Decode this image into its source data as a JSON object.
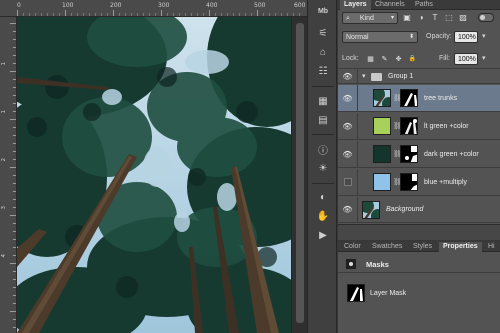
{
  "ruler_top": {
    "labels": [
      "0",
      "100",
      "200",
      "300",
      "400",
      "500",
      "600"
    ]
  },
  "ruler_left": {
    "labels": [
      "1",
      "1",
      "2",
      "3",
      "4"
    ]
  },
  "tools": [
    "mini-bridge-icon",
    "adjustments-icon",
    "paths-icon",
    "character-icon",
    "brushes-icon",
    "history-icon",
    "info-icon",
    "color-icon",
    "navigator-icon",
    "actions-icon",
    "play-icon"
  ],
  "tool_glyphs": [
    "Mb",
    "⚟",
    "⌂",
    "☷",
    "▦",
    "▤",
    "ⓘ",
    "☀",
    "◐",
    "✋",
    "▶"
  ],
  "layers_panel": {
    "tabs": [
      "Layers",
      "Channels",
      "Paths"
    ],
    "filter": {
      "kind_label": "Kind",
      "icons": [
        "image-filter-icon",
        "adjustment-filter-icon",
        "type-filter-icon",
        "shape-filter-icon",
        "smart-object-filter-icon"
      ],
      "glyphs": [
        "▣",
        "◑",
        "T",
        "⬚",
        "▨"
      ]
    },
    "blend_mode": "Normal",
    "opacity_label": "Opacity:",
    "opacity_value": "100%",
    "lock_label": "Lock:",
    "lock_icons": [
      "lock-transparent-icon",
      "lock-image-icon",
      "lock-position-icon",
      "lock-all-icon"
    ],
    "lock_glyphs": [
      "▦",
      "✎",
      "✥",
      "🔒"
    ],
    "fill_label": "Fill:",
    "fill_value": "100%",
    "group": {
      "name": "Group 1",
      "expanded": true
    },
    "layers": [
      {
        "name": "tree trunks",
        "visible": true,
        "selected": true,
        "thumb_color": "#3a5a6a",
        "has_mask": true,
        "in_group": true
      },
      {
        "name": "lt green +color",
        "visible": true,
        "selected": false,
        "thumb_color": "#a8d05a",
        "has_mask": true,
        "in_group": true
      },
      {
        "name": "dark green +color",
        "visible": true,
        "selected": false,
        "thumb_color": "#13352c",
        "has_mask": true,
        "in_group": true
      },
      {
        "name": "blue +multiply",
        "visible": false,
        "selected": false,
        "thumb_color": "#8fc3ea",
        "has_mask": true,
        "in_group": true
      },
      {
        "name": "Background",
        "visible": true,
        "selected": false,
        "thumb_color": "#3a5a6a",
        "has_mask": false,
        "in_group": false,
        "italic": true
      }
    ]
  },
  "properties_panel": {
    "tabs": [
      "Color",
      "Swatches",
      "Styles",
      "Properties",
      "Hi"
    ],
    "active_tab": "Properties",
    "section_title": "Masks",
    "mask_label": "Layer Mask"
  },
  "colors": {
    "selection": "#6b7a8c",
    "sky": "#aacde0",
    "foliage_dark": "#0f2a24",
    "foliage": "#1d4a3c",
    "trunk": "#5a4530"
  }
}
